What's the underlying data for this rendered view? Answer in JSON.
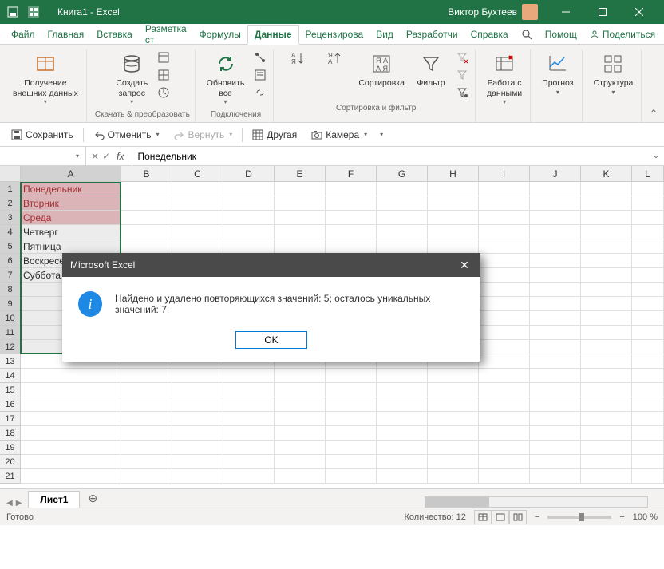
{
  "titlebar": {
    "app_title": "Книга1 - Excel",
    "username": "Виктор Бухтеев"
  },
  "menu": {
    "items": [
      "Файл",
      "Главная",
      "Вставка",
      "Разметка ст",
      "Формулы",
      "Данные",
      "Рецензирова",
      "Вид",
      "Разработчи",
      "Справка"
    ],
    "active_index": 5,
    "help_label": "Помощ",
    "share_label": "Поделиться"
  },
  "ribbon": {
    "groups": [
      {
        "label": "",
        "buttons": [
          {
            "label": "Получение\nвнешних данных"
          }
        ]
      },
      {
        "label": "Скачать & преобразовать",
        "buttons": [
          {
            "label": "Создать\nзапрос"
          }
        ]
      },
      {
        "label": "Подключения",
        "buttons": [
          {
            "label": "Обновить\nвсе"
          }
        ]
      },
      {
        "label": "Сортировка и фильтр",
        "buttons": [
          {
            "label": ""
          },
          {
            "label": "Сортировка"
          },
          {
            "label": "Фильтр"
          }
        ]
      },
      {
        "label": "",
        "buttons": [
          {
            "label": "Работа с\nданными"
          }
        ]
      },
      {
        "label": "",
        "buttons": [
          {
            "label": "Прогноз"
          }
        ]
      },
      {
        "label": "",
        "buttons": [
          {
            "label": "Структура"
          }
        ]
      }
    ]
  },
  "qat": {
    "save": "Сохранить",
    "undo": "Отменить",
    "redo": "Вернуть",
    "other": "Другая",
    "camera": "Камера"
  },
  "formula": {
    "name_box": "",
    "fx_label": "fx",
    "value": "Понедельник"
  },
  "columns": [
    "A",
    "B",
    "C",
    "D",
    "E",
    "F",
    "G",
    "H",
    "I",
    "J",
    "K",
    "L"
  ],
  "rows_visible": 21,
  "cell_data": [
    {
      "row": 1,
      "text": "Понедельник",
      "red": true
    },
    {
      "row": 2,
      "text": "Вторник",
      "red": true
    },
    {
      "row": 3,
      "text": "Среда",
      "red": true
    },
    {
      "row": 4,
      "text": "Четверг",
      "red": false
    },
    {
      "row": 5,
      "text": "Пятница",
      "red": false
    },
    {
      "row": 6,
      "text": "Воскресенье",
      "red": false
    },
    {
      "row": 7,
      "text": "Суббота",
      "red": false
    }
  ],
  "tabs": {
    "sheet": "Лист1"
  },
  "statusbar": {
    "ready": "Готово",
    "count_label": "Количество:",
    "count_value": "12",
    "zoom": "100 %"
  },
  "dialog": {
    "title": "Microsoft Excel",
    "message": "Найдено и удалено повторяющихся значений: 5; осталось уникальных значений: 7.",
    "ok": "OK"
  }
}
